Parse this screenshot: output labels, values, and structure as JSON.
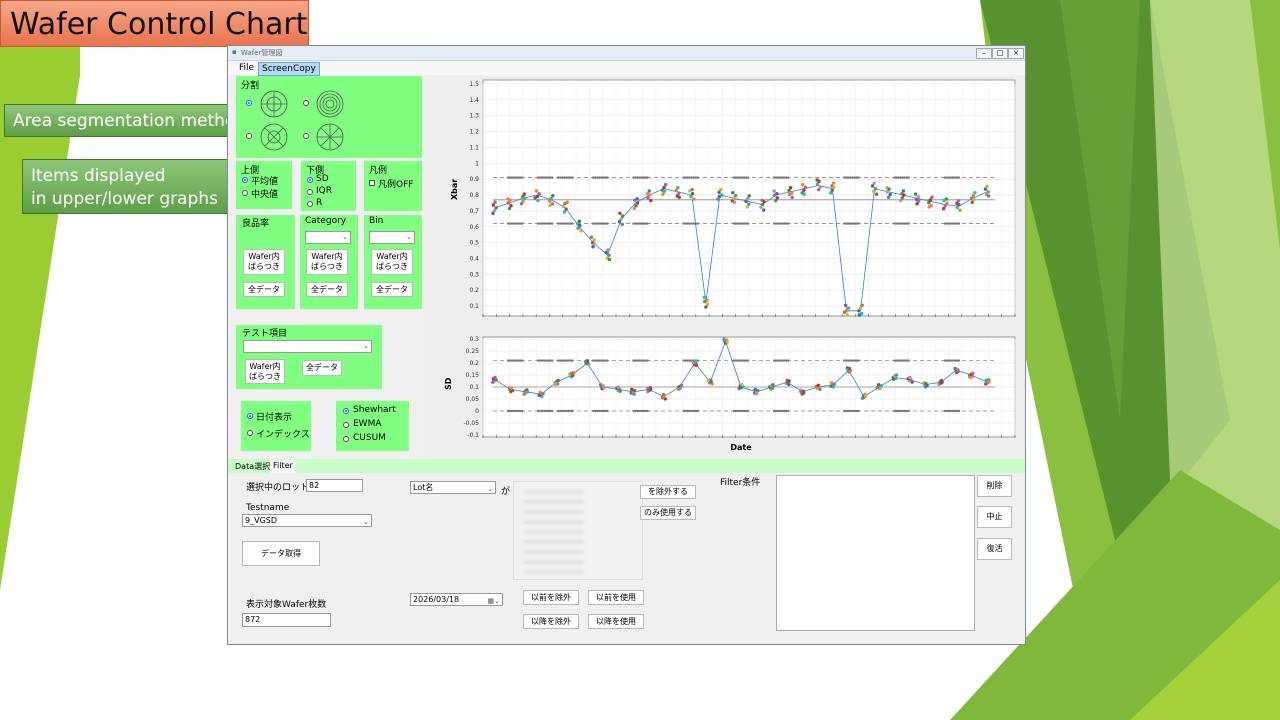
{
  "slide": {
    "title": "Wafer Control Chart",
    "callout_area": "Area segmentation method",
    "callout_items_line1": "Items displayed",
    "callout_items_line2": "in upper/lower graphs"
  },
  "window": {
    "title": "Wafer管理図",
    "min_icon": "minimize-icon",
    "max_icon": "maximize-icon",
    "close_icon": "close-icon"
  },
  "menu": {
    "file": "File",
    "screencopy": "ScreenCopy"
  },
  "panels": {
    "division_title": "分割",
    "upper_title": "上側",
    "upper_opt1": "平均値",
    "upper_opt2": "中央値",
    "lower_title": "下側",
    "lower_opt1": "SD",
    "lower_opt2": "IQR",
    "lower_opt3": "R",
    "legend_title": "凡例",
    "legend_off": "凡例OFF",
    "yield_title": "良品率",
    "category_title": "Category",
    "bin_title": "Bin",
    "wafer_inner_line1": "Wafer内",
    "wafer_inner_line2": "ばらつき",
    "all_data": "全データ",
    "test_item_title": "テスト項目",
    "date_display": "日付表示",
    "index": "インデックス",
    "shewhart": "Shewhart",
    "ewma": "EWMA",
    "cusum": "CUSUM"
  },
  "tabs": {
    "data_select": "Data選択",
    "filter": "Filter"
  },
  "lower": {
    "selected_lots_label": "選択中のロット数",
    "selected_lots_value": "82",
    "testname_label": "Testname",
    "testname_value": "9_VGSD",
    "get_data": "データ取得",
    "display_wafers_label": "表示対象Wafer枚数",
    "display_wafers_value": "872",
    "lot_name": "Lot名",
    "ga": "が",
    "exclude": "を除外する",
    "only_use": "のみ使用する",
    "date_value": "2026/03/18",
    "before_exclude": "以前を除外",
    "before_use": "以前を使用",
    "after_exclude": "以降を除外",
    "after_use": "以降を使用",
    "filter_cond": "Filter条件",
    "delete": "削除",
    "cancel": "中止",
    "restore": "復活"
  },
  "chart_data": [
    {
      "type": "scatter",
      "title": "",
      "xlabel": "",
      "ylabel": "Xbar",
      "ylim": [
        0.05,
        1.5
      ],
      "yticks": [
        "1.5",
        "1.4",
        "1.3",
        "1.2",
        "1.1",
        "1",
        "0.9",
        "0.8",
        "0.7",
        "0.6",
        "0.5",
        "0.4",
        "0.3",
        "0.2",
        "0.1"
      ],
      "control_limits": {
        "ucl": 0.91,
        "center": 0.77,
        "lcl": 0.62
      },
      "grid": true,
      "series": [
        {
          "values": [
            0.72,
            0.75,
            0.78,
            0.8,
            0.77,
            0.72,
            0.6,
            0.5,
            0.42,
            0.65,
            0.75,
            0.8,
            0.84,
            0.82,
            0.8,
            0.12,
            0.8,
            0.78,
            0.76,
            0.74,
            0.8,
            0.82,
            0.84,
            0.86,
            0.84,
            0.07,
            0.07,
            0.84,
            0.82,
            0.8,
            0.78,
            0.76,
            0.74,
            0.73,
            0.78,
            0.82
          ]
        }
      ]
    },
    {
      "type": "scatter",
      "title": "",
      "xlabel": "Date",
      "ylabel": "SD",
      "ylim": [
        -0.1,
        0.3
      ],
      "yticks": [
        "0.3",
        "0.25",
        "0.2",
        "0.15",
        "0.1",
        "0.05",
        "0",
        "-0.05",
        "-0.1"
      ],
      "control_limits": {
        "ucl": 0.21,
        "center": 0.1,
        "lcl": 0.0
      },
      "grid": true,
      "series": [
        {
          "values": [
            0.13,
            0.09,
            0.08,
            0.07,
            0.12,
            0.15,
            0.2,
            0.1,
            0.09,
            0.08,
            0.09,
            0.06,
            0.1,
            0.2,
            0.12,
            0.29,
            0.1,
            0.08,
            0.1,
            0.12,
            0.08,
            0.1,
            0.11,
            0.17,
            0.06,
            0.1,
            0.14,
            0.13,
            0.11,
            0.12,
            0.17,
            0.15,
            0.12
          ]
        }
      ]
    }
  ]
}
